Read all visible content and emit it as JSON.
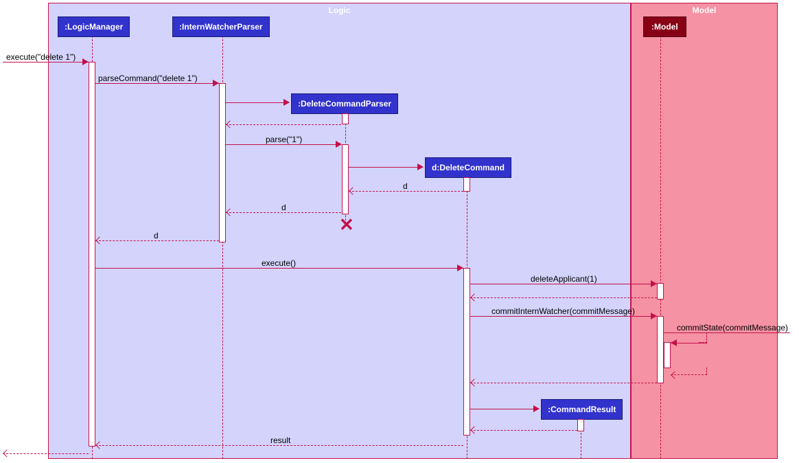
{
  "frames": {
    "logic": "Logic",
    "model": "Model"
  },
  "participants": {
    "logicManager": ":LogicManager",
    "internWatcherParser": ":InternWatcherParser",
    "deleteCommandParser": ":DeleteCommandParser",
    "deleteCommand": "d:DeleteCommand",
    "commandResult": ":CommandResult",
    "model": ":Model"
  },
  "messages": {
    "execute_delete1": "execute(\"delete 1\")",
    "parseCommand": "parseCommand(\"delete 1\")",
    "parse1": "parse(\"1\")",
    "d1": "d",
    "d2": "d",
    "d3": "d",
    "execute": "execute()",
    "deleteApplicant": "deleteApplicant(1)",
    "commitInternWatcher": "commitInternWatcher(commitMessage)",
    "commitState": "commitState(commitMessage)",
    "result": "result"
  }
}
